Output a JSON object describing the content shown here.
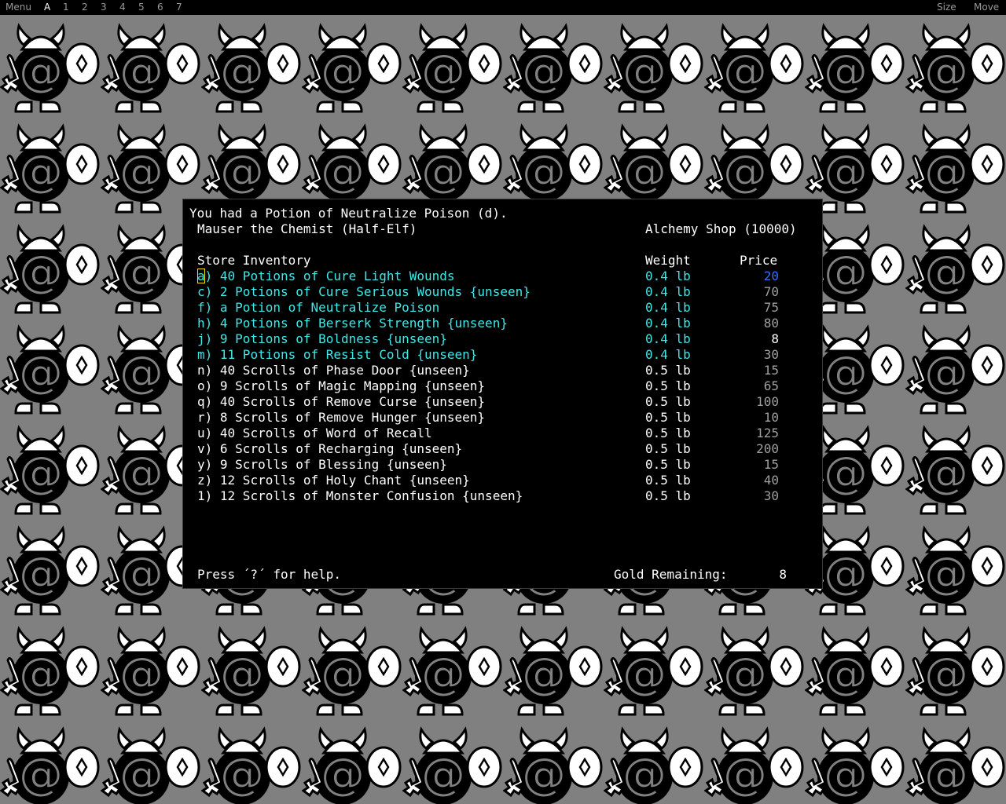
{
  "menubar": {
    "menu_label": "Menu",
    "tabs": [
      "A",
      "1",
      "2",
      "3",
      "4",
      "5",
      "6",
      "7"
    ],
    "size_label": "Size",
    "move_label": "Move"
  },
  "store": {
    "message": "You had a Potion of Neutralize Poison (d).",
    "owner": "Mauser the Chemist (Half-Elf)",
    "shop_name": "Alchemy Shop (10000)",
    "inventory_header": "Store Inventory",
    "weight_header": "Weight",
    "price_header": "Price",
    "items": [
      {
        "letter": "a",
        "rest": ") 40 Potions of Cure Light Wounds",
        "weight": "0.4 lb",
        "price": "20",
        "color": "cyan",
        "price_color": "blue",
        "selected": true
      },
      {
        "letter": "c",
        "rest": ") 2 Potions of Cure Serious Wounds {unseen}",
        "weight": "0.4 lb",
        "price": "70",
        "color": "cyan",
        "price_color": "grey"
      },
      {
        "letter": "f",
        "rest": ") a Potion of Neutralize Poison",
        "weight": "0.4 lb",
        "price": "75",
        "color": "cyan",
        "price_color": "grey"
      },
      {
        "letter": "h",
        "rest": ") 4 Potions of Berserk Strength {unseen}",
        "weight": "0.4 lb",
        "price": "80",
        "color": "cyan",
        "price_color": "grey"
      },
      {
        "letter": "j",
        "rest": ") 9 Potions of Boldness {unseen}",
        "weight": "0.4 lb",
        "price": "8",
        "color": "cyan",
        "price_color": "white"
      },
      {
        "letter": "m",
        "rest": ") 11 Potions of Resist Cold {unseen}",
        "weight": "0.4 lb",
        "price": "30",
        "color": "cyan",
        "price_color": "grey"
      },
      {
        "letter": "n",
        "rest": ") 40 Scrolls of Phase Door {unseen}",
        "weight": "0.5 lb",
        "price": "15",
        "color": "white",
        "price_color": "grey"
      },
      {
        "letter": "o",
        "rest": ") 9 Scrolls of Magic Mapping {unseen}",
        "weight": "0.5 lb",
        "price": "65",
        "color": "white",
        "price_color": "grey"
      },
      {
        "letter": "q",
        "rest": ") 40 Scrolls of Remove Curse {unseen}",
        "weight": "0.5 lb",
        "price": "100",
        "color": "white",
        "price_color": "grey"
      },
      {
        "letter": "r",
        "rest": ") 8 Scrolls of Remove Hunger {unseen}",
        "weight": "0.5 lb",
        "price": "10",
        "color": "white",
        "price_color": "grey"
      },
      {
        "letter": "u",
        "rest": ") 40 Scrolls of Word of Recall",
        "weight": "0.5 lb",
        "price": "125",
        "color": "white",
        "price_color": "grey"
      },
      {
        "letter": "v",
        "rest": ") 6 Scrolls of Recharging {unseen}",
        "weight": "0.5 lb",
        "price": "200",
        "color": "white",
        "price_color": "grey"
      },
      {
        "letter": "y",
        "rest": ") 9 Scrolls of Blessing {unseen}",
        "weight": "0.5 lb",
        "price": "15",
        "color": "white",
        "price_color": "grey"
      },
      {
        "letter": "z",
        "rest": ") 12 Scrolls of Holy Chant {unseen}",
        "weight": "0.5 lb",
        "price": "40",
        "color": "white",
        "price_color": "grey"
      },
      {
        "letter": "1",
        "rest": ") 12 Scrolls of Monster Confusion {unseen}",
        "weight": "0.5 lb",
        "price": "30",
        "color": "white",
        "price_color": "grey"
      }
    ],
    "help_text": "Press ´?´ for help.",
    "gold_label": "Gold Remaining:",
    "gold_value": "8"
  },
  "colors": {
    "background": "#808080",
    "window": "#000000",
    "cyan_text": "#40e8e8",
    "blue_price": "#3b6cff",
    "grey_price": "#a0a0a0",
    "cursor": "#ffe600"
  },
  "background_icon": "viking-at-sign-tile-icon"
}
